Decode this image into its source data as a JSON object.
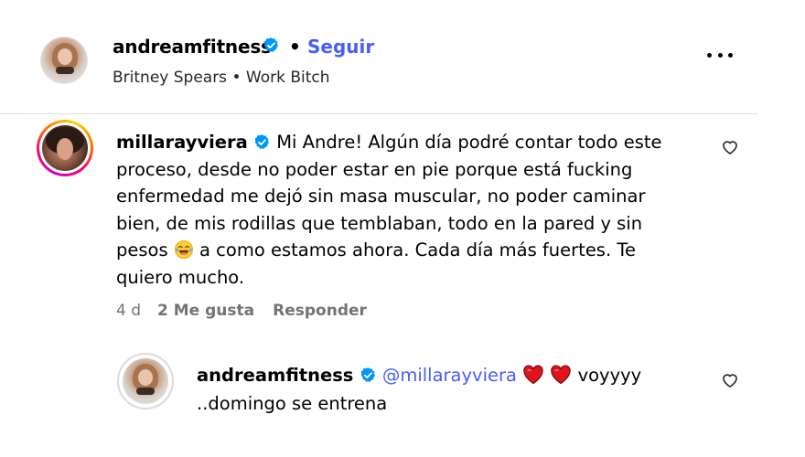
{
  "post_header": {
    "username": "andreamfitness",
    "separator": "•",
    "follow_label": "Seguir",
    "music": "Britney Spears • Work Bitch"
  },
  "comment": {
    "username": "millarayviera",
    "text_part1": "Mi Andre! Algún día podré contar todo este proceso, desde no poder estar en pie porque está fucking enfermedad me dejó sin masa muscular, no poder caminar bien, de mis rodillas que temblaban, todo en la pared y sin pesos",
    "text_part2": "a como estamos ahora. Cada día más fuertes. Te quiero mucho.",
    "emoji": "tears-of-joy-emoji",
    "time": "4 d",
    "likes": "2 Me gusta",
    "reply_label": "Responder"
  },
  "reply": {
    "username": "andreamfitness",
    "mention": "@millarayviera",
    "text_after_hearts": "voyyyy ..domingo se entrena",
    "emojis": [
      "red-heart-emoji",
      "red-heart-emoji"
    ]
  },
  "colors": {
    "link_blue": "#4a5df9",
    "verified_blue": "#0095f6",
    "meta_gray": "#737373",
    "heart_red": "#e0141e"
  },
  "icons": {
    "more": "more-options-icon",
    "like": "heart-outline-icon",
    "verified": "verified-badge-icon"
  }
}
